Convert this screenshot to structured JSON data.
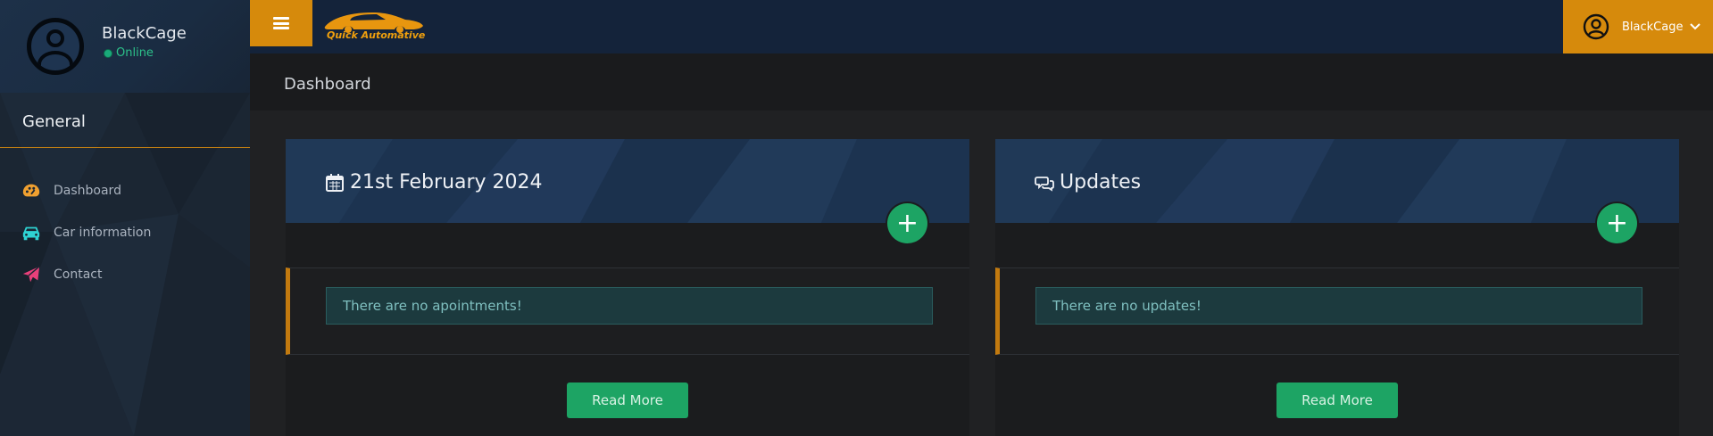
{
  "sidebar": {
    "profile": {
      "name": "BlackCage",
      "status": "Online"
    },
    "section_title": "General",
    "items": [
      {
        "label": "Dashboard",
        "icon": "palette-icon",
        "icon_color": "#f0a030"
      },
      {
        "label": "Car information",
        "icon": "car-icon",
        "icon_color": "#2ed3d3"
      },
      {
        "label": "Contact",
        "icon": "paper-plane-icon",
        "icon_color": "#e8407a"
      }
    ]
  },
  "topbar": {
    "brand": "Quick Automative",
    "user_name": "BlackCage",
    "accent": "#d68a0c"
  },
  "page": {
    "title": "Dashboard"
  },
  "cards": [
    {
      "title": "21st February 2024",
      "icon": "calendar-icon",
      "notice": "There are no apointments!",
      "button": "Read More"
    },
    {
      "title": "Updates",
      "icon": "comments-icon",
      "notice": "There are no updates!",
      "button": "Read More"
    }
  ],
  "colors": {
    "success": "#1da464",
    "card_header": "#1e3552",
    "sidebar": "#1b2633",
    "accent_border": "#c27a0f"
  }
}
